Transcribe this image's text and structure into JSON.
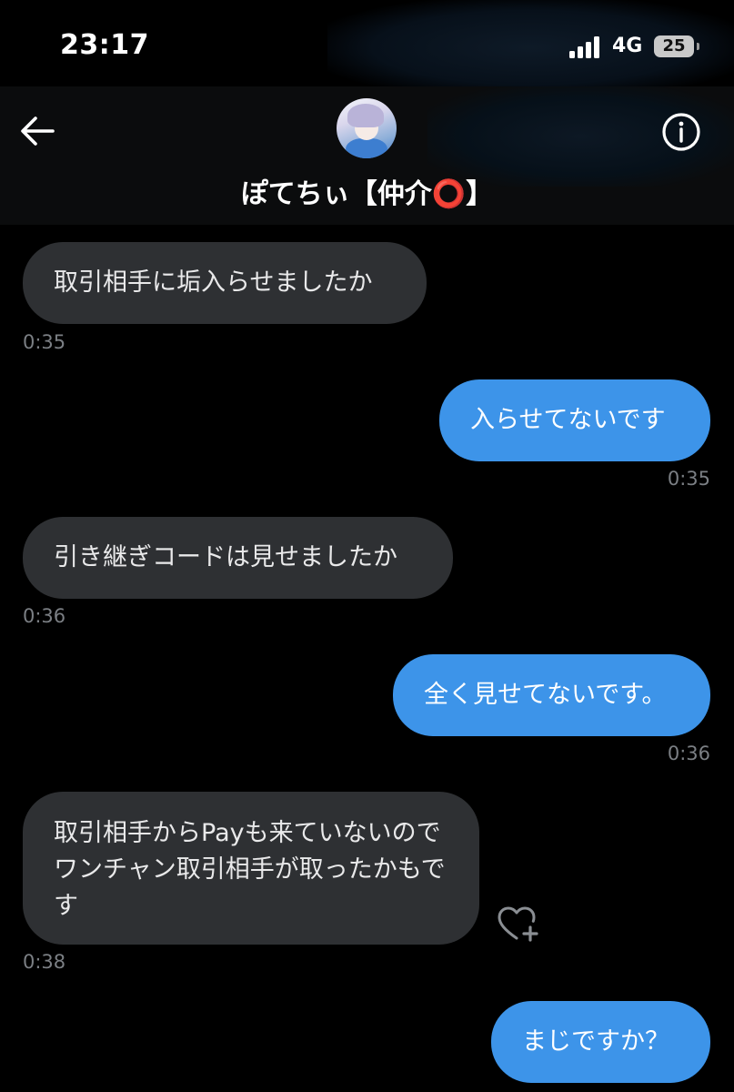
{
  "status_bar": {
    "time": "23:17",
    "network": "4G",
    "battery": "25"
  },
  "header": {
    "contact_name": "ぽてちぃ【仲介⭕️】",
    "back_icon": "arrow-left-icon",
    "info_icon": "info-circle-icon",
    "avatar_icon": "contact-avatar"
  },
  "messages": [
    {
      "direction": "incoming",
      "text": "取引相手に垢入らせましたか",
      "time": "0:35"
    },
    {
      "direction": "outgoing",
      "text": "入らせてないです",
      "time": "0:35"
    },
    {
      "direction": "incoming",
      "text": "引き継ぎコードは見せましたか",
      "time": "0:36"
    },
    {
      "direction": "outgoing",
      "text": "全く見せてないです。",
      "time": "0:36"
    },
    {
      "direction": "incoming",
      "text": "取引相手からPayも来ていないのでワンチャン取引相手が取ったかもです",
      "time": "0:38",
      "reaction_icon": "heart-add-icon"
    },
    {
      "direction": "outgoing",
      "text": "まじですか？"
    }
  ],
  "colors": {
    "background": "#000000",
    "incoming_bubble": "#2e3033",
    "outgoing_bubble": "#3d94e9",
    "timestamp": "#7b7f84"
  }
}
